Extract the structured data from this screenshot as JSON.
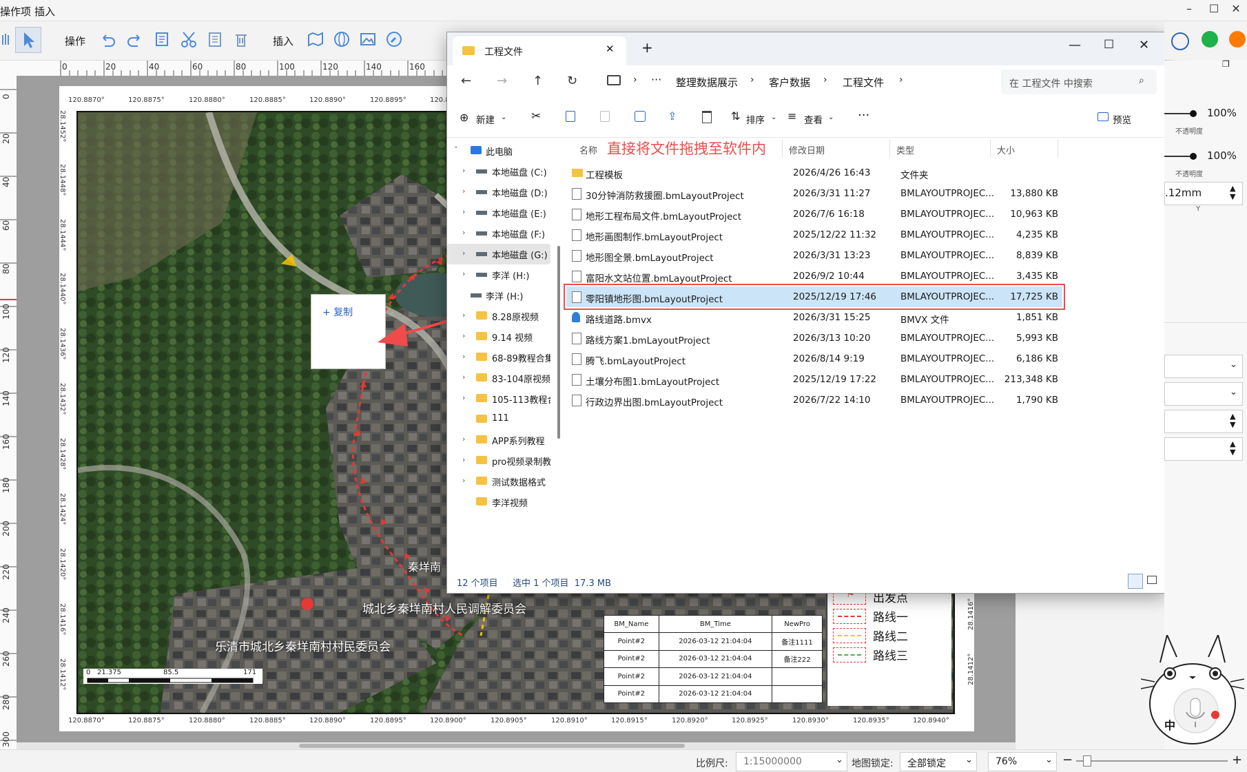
{
  "app": {
    "menu": [
      "操作项",
      "插入"
    ],
    "toolbar": {
      "operate_label": "操作",
      "insert_label": "插入"
    },
    "window_controls": {
      "minimize": "–",
      "maximize": "☐",
      "close": "✕"
    }
  },
  "rulers": {
    "top": [
      "0",
      "20",
      "40",
      "60",
      "80",
      "100",
      "120",
      "140",
      "160"
    ],
    "left": [
      "0",
      "20",
      "40",
      "60",
      "80",
      "100",
      "120",
      "140",
      "160",
      "180",
      "200",
      "220",
      "240",
      "260",
      "280",
      "300"
    ]
  },
  "map": {
    "coords_top": [
      "120.8870°",
      "120.8875°",
      "120.8880°",
      "120.8885°",
      "120.8890°",
      "120.8895°",
      "120.8"
    ],
    "coords_bottom": [
      "120.8870°",
      "120.8875°",
      "120.8880°",
      "120.8885°",
      "120.8890°",
      "120.8895°",
      "120.8900°",
      "120.8905°",
      "120.8910°",
      "120.8915°",
      "120.8920°",
      "120.8925°",
      "120.8930°",
      "120.8935°",
      "120.8940°"
    ],
    "coords_left": [
      "28.1452°",
      "28.1448°",
      "28.1444°",
      "28.1440°",
      "28.1436°",
      "28.1432°",
      "28.1428°",
      "28.1424°",
      "28.1420°",
      "28.1416°",
      "28.1412°"
    ],
    "coords_right": [
      "28.1416°",
      "28.1412°"
    ],
    "place_labels": [
      "城北乡秦垟南村人民调解委员会",
      "乐清市城北乡秦垟南村村民委员会",
      "秦垟南"
    ],
    "scalebar": [
      "0",
      "21.375",
      "85.5",
      "171"
    ],
    "drag_copy_label": "+ 复制",
    "annotation": "直接将文件拖拽至软件内",
    "legend": [
      {
        "label": "出发点",
        "color": "#e53935"
      },
      {
        "label": "路线一",
        "color": "#e53935"
      },
      {
        "label": "路线二",
        "color": "#f5c400"
      },
      {
        "label": "路线三",
        "color": "#4caf50"
      }
    ],
    "attr_table": {
      "headers": [
        "BM_Name",
        "BM_Time",
        "NewPro"
      ],
      "rows": [
        [
          "Point#2",
          "2026-03-12 21:04:04",
          "备注1111"
        ],
        [
          "Point#2",
          "2026-03-12 21:04:04",
          "备注222"
        ],
        [
          "Point#2",
          "2026-03-12 21:04:04",
          ""
        ],
        [
          "Point#2",
          "2026-03-12 21:04:04",
          ""
        ]
      ]
    }
  },
  "explorer": {
    "tab_title": "工程文件",
    "new_tab": "+",
    "breadcrumbs": [
      "整理数据展示",
      "客户数据",
      "工程文件"
    ],
    "search_placeholder": "在 工程文件 中搜索",
    "commands": {
      "new": "新建",
      "sort": "排序",
      "view": "查看",
      "more": "···",
      "preview": "预览"
    },
    "nav": [
      {
        "label": "此电脑",
        "icon": "computer-icon",
        "expanded": true
      },
      {
        "label": "本地磁盘 (C:)",
        "icon": "drive-icon"
      },
      {
        "label": "本地磁盘 (D:)",
        "icon": "drive-icon"
      },
      {
        "label": "本地磁盘 (E:)",
        "icon": "drive-icon"
      },
      {
        "label": "本地磁盘 (F:)",
        "icon": "drive-icon"
      },
      {
        "label": "本地磁盘 (G:)",
        "icon": "drive-icon",
        "selected": true
      },
      {
        "label": "李洋 (H:)",
        "icon": "drive-icon"
      },
      {
        "label": "李洋 (H:)",
        "icon": "drive-icon"
      },
      {
        "label": "8.28原视频",
        "icon": "folder-icon"
      },
      {
        "label": "9.14 视频",
        "icon": "folder-icon"
      },
      {
        "label": "68-89教程合集",
        "icon": "folder-icon"
      },
      {
        "label": "83-104原视频",
        "icon": "folder-icon"
      },
      {
        "label": "105-113教程合",
        "icon": "folder-icon"
      },
      {
        "label": "111",
        "icon": "folder-icon"
      },
      {
        "label": "APP系列教程",
        "icon": "folder-icon"
      },
      {
        "label": "pro视频录制教",
        "icon": "folder-icon"
      },
      {
        "label": "测试数据格式",
        "icon": "folder-icon"
      },
      {
        "label": "李洋视频",
        "icon": "folder-icon"
      }
    ],
    "columns": {
      "name": "名称",
      "date": "修改日期",
      "type": "类型",
      "size": "大小"
    },
    "files": [
      {
        "name": "工程模板",
        "date": "2026/4/26 16:43",
        "type": "文件夹",
        "size": "",
        "icon": "folder-icon"
      },
      {
        "name": "30分钟消防救援圈.bmLayoutProject",
        "date": "2026/3/31 11:27",
        "type": "BMLAYOUTPROJEC...",
        "size": "13,880 KB",
        "icon": "file-icon"
      },
      {
        "name": "地形工程布局文件.bmLayoutProject",
        "date": "2026/7/6 16:18",
        "type": "BMLAYOUTPROJEC...",
        "size": "10,963 KB",
        "icon": "file-icon"
      },
      {
        "name": "地形画图制作.bmLayoutProject",
        "date": "2025/12/22 11:32",
        "type": "BMLAYOUTPROJEC...",
        "size": "4,235 KB",
        "icon": "file-icon"
      },
      {
        "name": "地形图全景.bmLayoutProject",
        "date": "2026/3/31 13:23",
        "type": "BMLAYOUTPROJEC...",
        "size": "8,839 KB",
        "icon": "file-icon"
      },
      {
        "name": "富阳水文站位置.bmLayoutProject",
        "date": "2026/9/2 10:44",
        "type": "BMLAYOUTPROJEC...",
        "size": "3,435 KB",
        "icon": "file-icon"
      },
      {
        "name": "零阳镇地形图.bmLayoutProject",
        "date": "2025/12/19 17:46",
        "type": "BMLAYOUTPROJEC...",
        "size": "17,725 KB",
        "icon": "file-icon",
        "selected": true
      },
      {
        "name": "路线道路.bmvx",
        "date": "2026/3/31 15:25",
        "type": "BMVX 文件",
        "size": "1,851 KB",
        "icon": "bmvx-icon"
      },
      {
        "name": "路线方案1.bmLayoutProject",
        "date": "2026/3/13 10:20",
        "type": "BMLAYOUTPROJEC...",
        "size": "5,993 KB",
        "icon": "file-icon"
      },
      {
        "name": "腾飞.bmLayoutProject",
        "date": "2026/8/14 9:19",
        "type": "BMLAYOUTPROJEC...",
        "size": "6,186 KB",
        "icon": "file-icon"
      },
      {
        "name": "土壤分布图1.bmLayoutProject",
        "date": "2025/12/19 17:22",
        "type": "BMLAYOUTPROJEC...",
        "size": "213,348 KB",
        "icon": "file-icon"
      },
      {
        "name": "行政边界出图.bmLayoutProject",
        "date": "2026/7/22 14:10",
        "type": "BMLAYOUTPROJEC...",
        "size": "1,790 KB",
        "icon": "file-icon"
      }
    ],
    "status": {
      "count": "12 个项目",
      "selection": "选中 1 个项目  17.3 MB"
    }
  },
  "right_panel": {
    "opacity1": "100%",
    "opacity1_label": "不透明度",
    "opacity2": "100%",
    "opacity2_label": "不透明度",
    "y_value": ".12mm",
    "y_label": "Y"
  },
  "statusbar": {
    "scale_label": "比例尺:",
    "scale_value": "1:15000000",
    "lock_label": "地图锁定:",
    "lock_value": "全部锁定",
    "zoom": "76%",
    "ime": "中"
  }
}
